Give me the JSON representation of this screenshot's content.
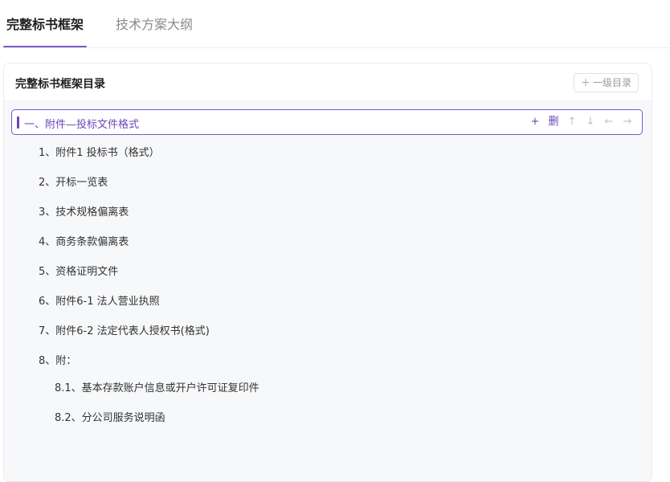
{
  "tabs": [
    {
      "label": "完整标书框架"
    },
    {
      "label": "技术方案大纲"
    }
  ],
  "card": {
    "title": "完整标书框架目录",
    "add_top_label": "一级目录"
  },
  "selected": {
    "label": "一、附件—投标文件格式",
    "actions": {
      "add": "+",
      "delete": "删",
      "up": "↑",
      "down": "↓",
      "left": "←",
      "right": "→"
    }
  },
  "items": [
    {
      "label": "1、附件1 投标书（格式）"
    },
    {
      "label": "2、开标一览表"
    },
    {
      "label": "3、技术规格偏离表"
    },
    {
      "label": "4、商务条款偏离表"
    },
    {
      "label": "5、资格证明文件"
    },
    {
      "label": "6、附件6-1 法人营业执照"
    },
    {
      "label": "7、附件6-2 法定代表人授权书(格式)"
    },
    {
      "label": "8、附："
    }
  ],
  "subitems": [
    {
      "label": "8.1、基本存款账户信息或开户许可证复印件"
    },
    {
      "label": "8.2、分公司服务说明函"
    }
  ],
  "colors": {
    "accent": "#7b57c7",
    "accent_text": "#6a45b8"
  }
}
